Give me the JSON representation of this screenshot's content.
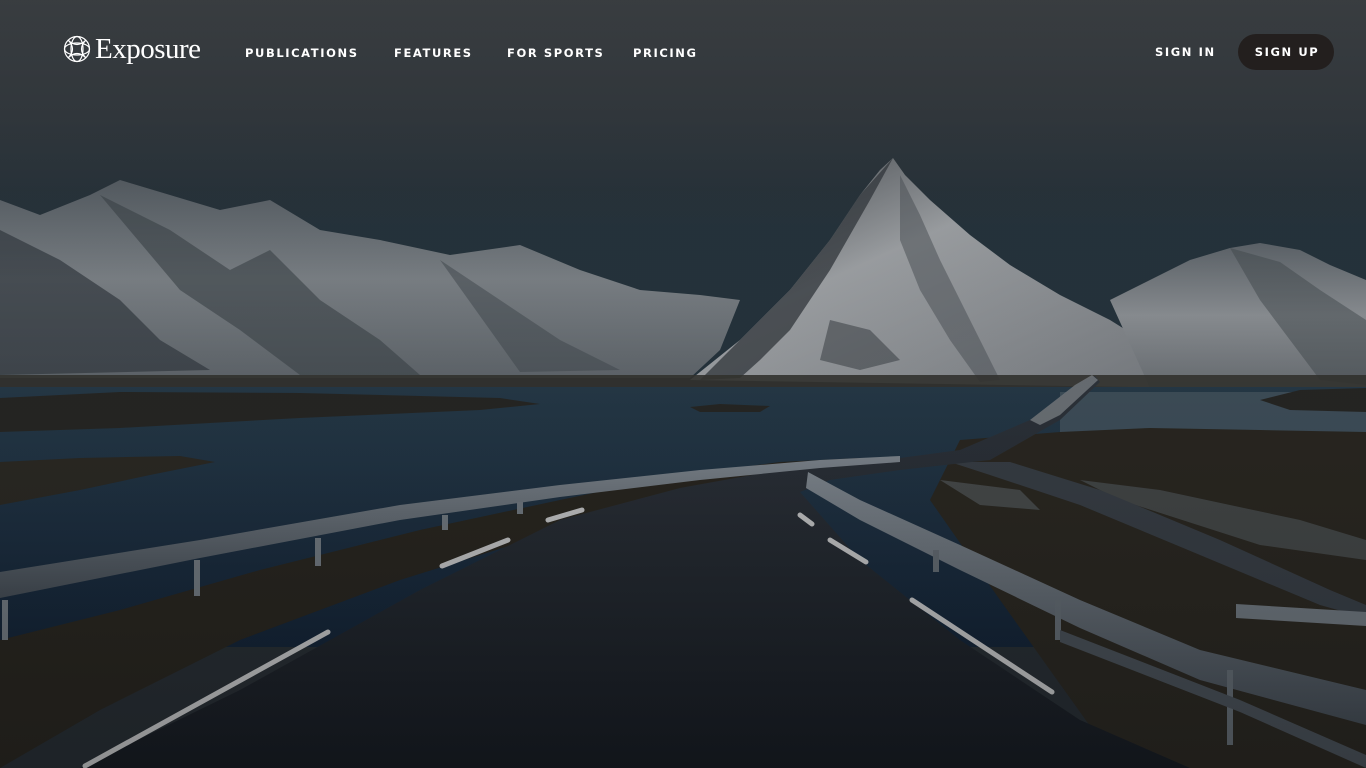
{
  "brand": {
    "name": "Exposure",
    "logo_icon": "globe-lattice-icon"
  },
  "nav": {
    "items": [
      {
        "label": "PUBLICATIONS"
      },
      {
        "label": "FEATURES"
      },
      {
        "label": "FOR SPORTS"
      },
      {
        "label": "PRICING"
      }
    ]
  },
  "auth": {
    "sign_in_label": "SIGN IN",
    "sign_up_label": "SIGN UP"
  },
  "hero": {
    "image_description": "Snow-capped mountains beside a fjord with a winding coastal road and guardrails under an overcast sky",
    "colors": {
      "sky_top": "#44484b",
      "sky_mid": "#2f3940",
      "water": "#1e3142",
      "snow": "#b9bcc0",
      "road": "#1b1f26",
      "signup_bg": "#231f1e"
    }
  }
}
